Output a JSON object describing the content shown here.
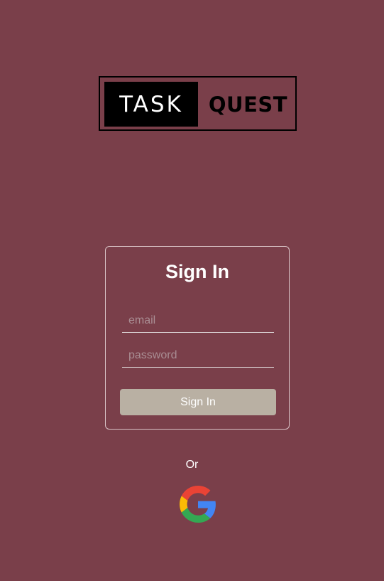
{
  "logo": {
    "part1": "TASK",
    "part2": "QUEST"
  },
  "signin_card": {
    "title": "Sign In",
    "email_placeholder": "email",
    "password_placeholder": "password",
    "submit_label": "Sign In"
  },
  "alt_login": {
    "divider_text": "Or",
    "provider_icon": "google-icon"
  },
  "colors": {
    "background": "#7a3f4a",
    "button": "#b9b0a3",
    "logo_dark": "#000000",
    "google_red": "#EA4335",
    "google_yellow": "#FBBC05",
    "google_green": "#34A853",
    "google_blue": "#4285F4"
  }
}
